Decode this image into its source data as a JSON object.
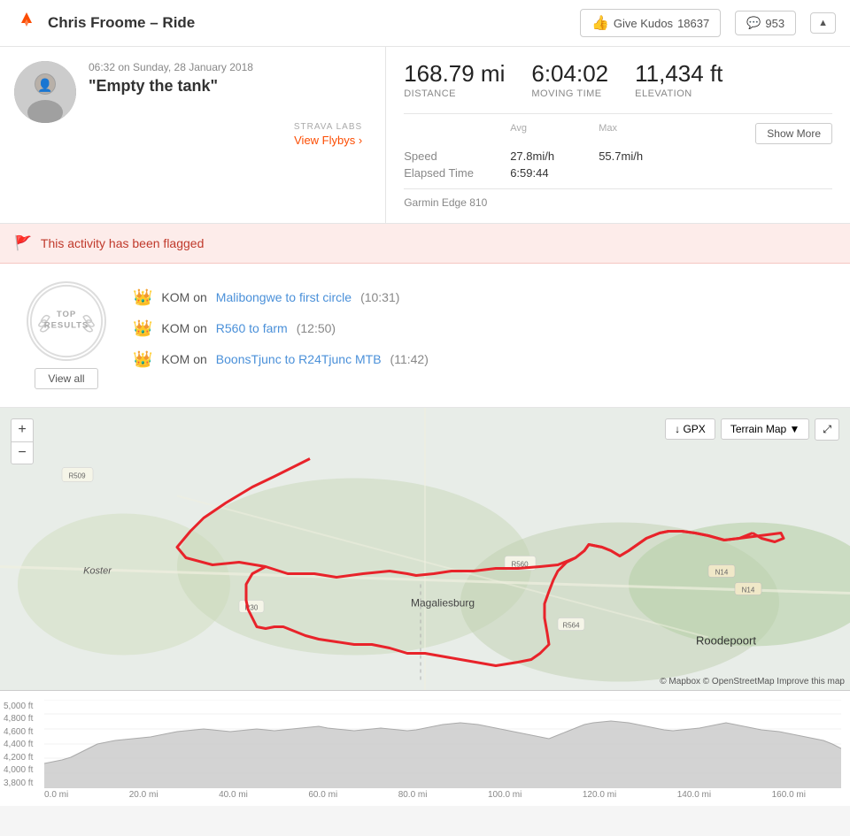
{
  "header": {
    "title": "Chris Froome – Ride",
    "kudos_count": "18637",
    "comment_count": "953",
    "give_kudos_label": "Give Kudos",
    "chevron_label": "▲"
  },
  "activity": {
    "date": "06:32 on Sunday, 28 January 2018",
    "name": "\"Empty the tank\"",
    "strava_labs_label": "STRAVA LABS",
    "view_flybys_label": "View Flybys ›"
  },
  "stats": {
    "distance_value": "168.79 mi",
    "distance_label": "Distance",
    "moving_time_value": "6:04:02",
    "moving_time_label": "Moving Time",
    "elevation_value": "11,434 ft",
    "elevation_label": "Elevation",
    "avg_label": "Avg",
    "max_label": "Max",
    "speed_label": "Speed",
    "speed_avg": "27.8mi/h",
    "speed_max": "55.7mi/h",
    "elapsed_label": "Elapsed Time",
    "elapsed_value": "6:59:44",
    "show_more_label": "Show More",
    "device": "Garmin Edge 810"
  },
  "flagged": {
    "message": "This activity has been flagged"
  },
  "top_results": {
    "badge_top": "TOP",
    "badge_bottom": "RESULTS",
    "view_all_label": "View all",
    "koms": [
      {
        "prefix": "KOM on ",
        "segment": "Malibongwe to first circle",
        "time": "(10:31)"
      },
      {
        "prefix": "KOM on ",
        "segment": "R560 to farm",
        "time": "(12:50)"
      },
      {
        "prefix": "KOM on ",
        "segment": "BoonsTjunc to R24Tjunc MTB",
        "time": "(11:42)"
      }
    ]
  },
  "map": {
    "zoom_in_label": "+",
    "zoom_out_label": "−",
    "gpx_label": "↓ GPX",
    "terrain_label": "Terrain Map ▼",
    "expand_label": "⤢",
    "attribution": "© Mapbox © OpenStreetMap Improve this map"
  },
  "elevation": {
    "y_labels": [
      "5,000 ft",
      "4,800 ft",
      "4,600 ft",
      "4,400 ft",
      "4,200 ft",
      "4,000 ft",
      "3,800 ft"
    ],
    "x_labels": [
      "0.0 mi",
      "20.0 mi",
      "40.0 mi",
      "60.0 mi",
      "80.0 mi",
      "100.0 mi",
      "120.0 mi",
      "140.0 mi",
      "160.0 mi"
    ]
  }
}
